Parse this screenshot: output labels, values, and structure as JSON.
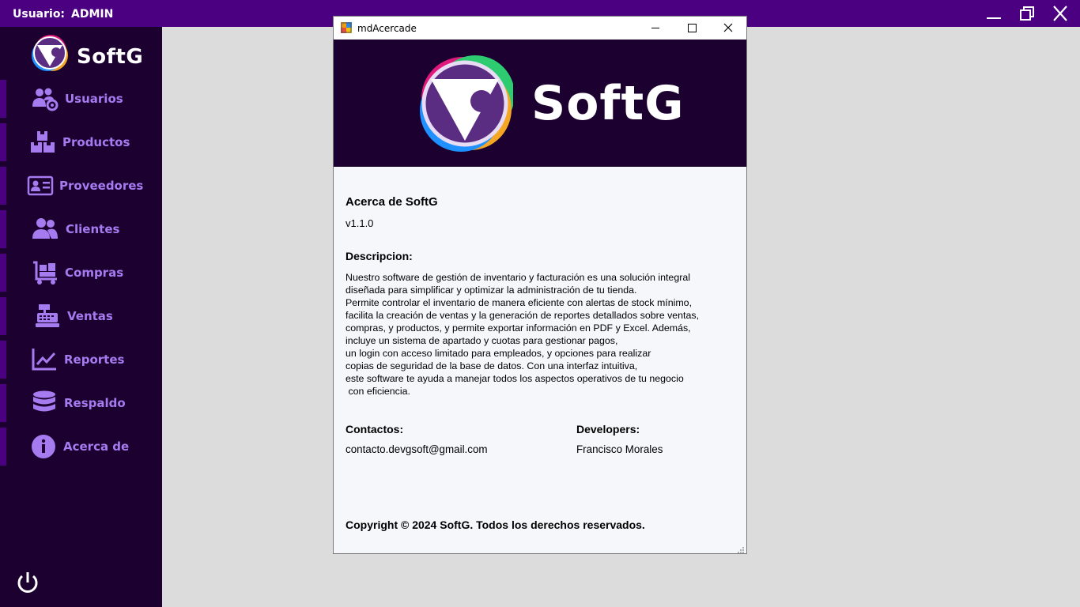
{
  "topbar": {
    "user_label": "Usuario:",
    "user_value": "ADMIN",
    "controls": [
      "minimize-icon",
      "restore-icon",
      "close-icon"
    ]
  },
  "sidebar": {
    "brand": "SoftG",
    "items": [
      {
        "label": "Usuarios",
        "icon": "users-gear-icon"
      },
      {
        "label": "Productos",
        "icon": "boxes-icon"
      },
      {
        "label": "Proveedores",
        "icon": "contact-card-icon"
      },
      {
        "label": "Clientes",
        "icon": "people-icon"
      },
      {
        "label": "Compras",
        "icon": "cart-icon"
      },
      {
        "label": "Ventas",
        "icon": "cash-register-icon"
      },
      {
        "label": "Reportes",
        "icon": "chart-line-icon"
      },
      {
        "label": "Respaldo",
        "icon": "database-icon"
      },
      {
        "label": "Acerca de",
        "icon": "info-icon"
      }
    ],
    "power_icon": "power-icon"
  },
  "dialog": {
    "title": "mdAcercade",
    "banner_text": "SoftG",
    "about_title": "Acerca de SoftG",
    "version": "v1.1.0",
    "description_heading": "Descripcion:",
    "description": "Nuestro software de gestión de inventario y facturación es una solución integral\ndiseñada para simplificar y optimizar la administración de tu tienda.\nPermite controlar el inventario de manera eficiente con alertas de stock mínimo,\nfacilita la creación de ventas y la generación de reportes detallados sobre ventas,\ncompras, y productos, y permite exportar información en PDF y Excel. Además,\nincluye un sistema de apartado y cuotas para gestionar pagos,\nun login con acceso limitado para empleados, y opciones para realizar\ncopias de seguridad de la base de datos. Con una interfaz intuitiva,\neste software te ayuda a manejar todos los aspectos operativos de tu negocio\n con eficiencia.",
    "contacts_heading": "Contactos:",
    "contacts_value": "contacto.devgsoft@gmail.com",
    "developers_heading": "Developers:",
    "developers_value": "Francisco Morales",
    "copyright": "Copyright © 2024 SoftG. Todos los derechos reservados."
  },
  "colors": {
    "topbar": "#4b0082",
    "sidebar": "#1c0030",
    "nav_text": "#a77bf0",
    "dialog_bg": "#f5f7fb",
    "desktop": "#dcdcdc"
  }
}
